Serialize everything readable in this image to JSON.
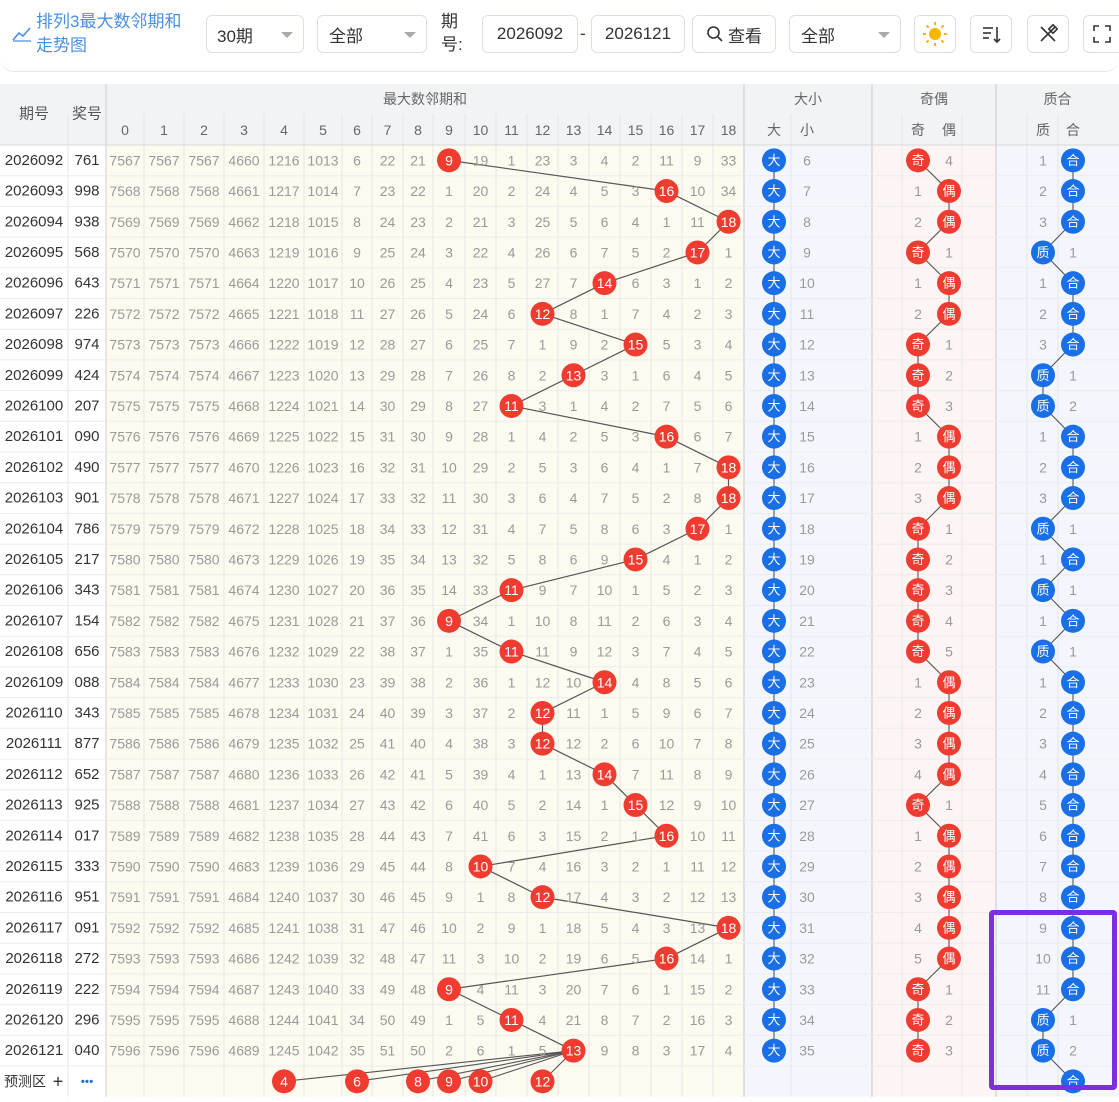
{
  "toolbar": {
    "title": "排列3最大数邻期和走势图",
    "periods_select": "30期",
    "scope_select": "全部",
    "period_label": "期号:",
    "start_issue": "2026092",
    "separator": "-",
    "end_issue": "2026121",
    "query_button": "查看",
    "filter_select": "全部",
    "icons": [
      "chart-line-icon",
      "sun-icon",
      "sort-icon",
      "tools-icon",
      "fullscreen-icon"
    ]
  },
  "table": {
    "col_issue": "期号",
    "col_prize": "奖号",
    "group_main": "最大数邻期和",
    "group_size": "大小",
    "group_parity": "奇偶",
    "group_prime": "质合",
    "main_cols": [
      "0",
      "1",
      "2",
      "3",
      "4",
      "5",
      "6",
      "7",
      "8",
      "9",
      "10",
      "11",
      "12",
      "13",
      "14",
      "15",
      "16",
      "17",
      "18"
    ],
    "size_cols": [
      "大",
      "小"
    ],
    "parity_cols": [
      "奇",
      "偶"
    ],
    "prime_cols": [
      "质",
      "合"
    ],
    "rows": [
      {
        "issue": "2026092",
        "prize": "761",
        "main": [
          "7567",
          "7567",
          "7567",
          "4660",
          "1216",
          "1013",
          "6",
          "22",
          "21",
          "9",
          "19",
          "1",
          "23",
          "3",
          "4",
          "2",
          "11",
          "9",
          "33"
        ],
        "hit": 9,
        "size_hit": "大",
        "size_val": "6",
        "parity_hit": "奇",
        "parity_val": "4",
        "prime_hit": "合",
        "prime_val": "1"
      },
      {
        "issue": "2026093",
        "prize": "998",
        "main": [
          "7568",
          "7568",
          "7568",
          "4661",
          "1217",
          "1014",
          "7",
          "23",
          "22",
          "1",
          "20",
          "2",
          "24",
          "4",
          "5",
          "3",
          "16",
          "10",
          "34"
        ],
        "hit": 16,
        "size_hit": "大",
        "size_val": "7",
        "parity_hit": "偶",
        "parity_val": "1",
        "prime_hit": "合",
        "prime_val": "2"
      },
      {
        "issue": "2026094",
        "prize": "938",
        "main": [
          "7569",
          "7569",
          "7569",
          "4662",
          "1218",
          "1015",
          "8",
          "24",
          "23",
          "2",
          "21",
          "3",
          "25",
          "5",
          "6",
          "4",
          "1",
          "11",
          "18"
        ],
        "hit": 18,
        "size_hit": "大",
        "size_val": "8",
        "parity_hit": "偶",
        "parity_val": "2",
        "prime_hit": "合",
        "prime_val": "3"
      },
      {
        "issue": "2026095",
        "prize": "568",
        "main": [
          "7570",
          "7570",
          "7570",
          "4663",
          "1219",
          "1016",
          "9",
          "25",
          "24",
          "3",
          "22",
          "4",
          "26",
          "6",
          "7",
          "5",
          "2",
          "17",
          "1"
        ],
        "hit": 17,
        "size_hit": "大",
        "size_val": "9",
        "parity_hit": "奇",
        "parity_val": "1",
        "prime_hit": "质",
        "prime_val": "1"
      },
      {
        "issue": "2026096",
        "prize": "643",
        "main": [
          "7571",
          "7571",
          "7571",
          "4664",
          "1220",
          "1017",
          "10",
          "26",
          "25",
          "4",
          "23",
          "5",
          "27",
          "7",
          "14",
          "6",
          "3",
          "1",
          "2"
        ],
        "hit": 14,
        "size_hit": "大",
        "size_val": "10",
        "parity_hit": "偶",
        "parity_val": "1",
        "prime_hit": "合",
        "prime_val": "1"
      },
      {
        "issue": "2026097",
        "prize": "226",
        "main": [
          "7572",
          "7572",
          "7572",
          "4665",
          "1221",
          "1018",
          "11",
          "27",
          "26",
          "5",
          "24",
          "6",
          "12",
          "8",
          "1",
          "7",
          "4",
          "2",
          "3"
        ],
        "hit": 12,
        "size_hit": "大",
        "size_val": "11",
        "parity_hit": "偶",
        "parity_val": "2",
        "prime_hit": "合",
        "prime_val": "2"
      },
      {
        "issue": "2026098",
        "prize": "974",
        "main": [
          "7573",
          "7573",
          "7573",
          "4666",
          "1222",
          "1019",
          "12",
          "28",
          "27",
          "6",
          "25",
          "7",
          "1",
          "9",
          "2",
          "15",
          "5",
          "3",
          "4"
        ],
        "hit": 15,
        "size_hit": "大",
        "size_val": "12",
        "parity_hit": "奇",
        "parity_val": "1",
        "prime_hit": "合",
        "prime_val": "3"
      },
      {
        "issue": "2026099",
        "prize": "424",
        "main": [
          "7574",
          "7574",
          "7574",
          "4667",
          "1223",
          "1020",
          "13",
          "29",
          "28",
          "7",
          "26",
          "8",
          "2",
          "13",
          "3",
          "1",
          "6",
          "4",
          "5"
        ],
        "hit": 13,
        "size_hit": "大",
        "size_val": "13",
        "parity_hit": "奇",
        "parity_val": "2",
        "prime_hit": "质",
        "prime_val": "1"
      },
      {
        "issue": "2026100",
        "prize": "207",
        "main": [
          "7575",
          "7575",
          "7575",
          "4668",
          "1224",
          "1021",
          "14",
          "30",
          "29",
          "8",
          "27",
          "11",
          "3",
          "1",
          "4",
          "2",
          "7",
          "5",
          "6"
        ],
        "hit": 11,
        "size_hit": "大",
        "size_val": "14",
        "parity_hit": "奇",
        "parity_val": "3",
        "prime_hit": "质",
        "prime_val": "2"
      },
      {
        "issue": "2026101",
        "prize": "090",
        "main": [
          "7576",
          "7576",
          "7576",
          "4669",
          "1225",
          "1022",
          "15",
          "31",
          "30",
          "9",
          "28",
          "1",
          "4",
          "2",
          "5",
          "3",
          "16",
          "6",
          "7"
        ],
        "hit": 16,
        "size_hit": "大",
        "size_val": "15",
        "parity_hit": "偶",
        "parity_val": "1",
        "prime_hit": "合",
        "prime_val": "1"
      },
      {
        "issue": "2026102",
        "prize": "490",
        "main": [
          "7577",
          "7577",
          "7577",
          "4670",
          "1226",
          "1023",
          "16",
          "32",
          "31",
          "10",
          "29",
          "2",
          "5",
          "3",
          "6",
          "4",
          "1",
          "7",
          "18"
        ],
        "hit": 18,
        "size_hit": "大",
        "size_val": "16",
        "parity_hit": "偶",
        "parity_val": "2",
        "prime_hit": "合",
        "prime_val": "2"
      },
      {
        "issue": "2026103",
        "prize": "901",
        "main": [
          "7578",
          "7578",
          "7578",
          "4671",
          "1227",
          "1024",
          "17",
          "33",
          "32",
          "11",
          "30",
          "3",
          "6",
          "4",
          "7",
          "5",
          "2",
          "8",
          "18"
        ],
        "hit": 18,
        "size_hit": "大",
        "size_val": "17",
        "parity_hit": "偶",
        "parity_val": "3",
        "prime_hit": "合",
        "prime_val": "3"
      },
      {
        "issue": "2026104",
        "prize": "786",
        "main": [
          "7579",
          "7579",
          "7579",
          "4672",
          "1228",
          "1025",
          "18",
          "34",
          "33",
          "12",
          "31",
          "4",
          "7",
          "5",
          "8",
          "6",
          "3",
          "17",
          "1"
        ],
        "hit": 17,
        "size_hit": "大",
        "size_val": "18",
        "parity_hit": "奇",
        "parity_val": "1",
        "prime_hit": "质",
        "prime_val": "1"
      },
      {
        "issue": "2026105",
        "prize": "217",
        "main": [
          "7580",
          "7580",
          "7580",
          "4673",
          "1229",
          "1026",
          "19",
          "35",
          "34",
          "13",
          "32",
          "5",
          "8",
          "6",
          "9",
          "15",
          "4",
          "1",
          "2"
        ],
        "hit": 15,
        "size_hit": "大",
        "size_val": "19",
        "parity_hit": "奇",
        "parity_val": "2",
        "prime_hit": "合",
        "prime_val": "1"
      },
      {
        "issue": "2026106",
        "prize": "343",
        "main": [
          "7581",
          "7581",
          "7581",
          "4674",
          "1230",
          "1027",
          "20",
          "36",
          "35",
          "14",
          "33",
          "11",
          "9",
          "7",
          "10",
          "1",
          "5",
          "2",
          "3"
        ],
        "hit": 11,
        "size_hit": "大",
        "size_val": "20",
        "parity_hit": "奇",
        "parity_val": "3",
        "prime_hit": "质",
        "prime_val": "1"
      },
      {
        "issue": "2026107",
        "prize": "154",
        "main": [
          "7582",
          "7582",
          "7582",
          "4675",
          "1231",
          "1028",
          "21",
          "37",
          "36",
          "9",
          "34",
          "1",
          "10",
          "8",
          "11",
          "2",
          "6",
          "3",
          "4"
        ],
        "hit": 9,
        "size_hit": "大",
        "size_val": "21",
        "parity_hit": "奇",
        "parity_val": "4",
        "prime_hit": "合",
        "prime_val": "1"
      },
      {
        "issue": "2026108",
        "prize": "656",
        "main": [
          "7583",
          "7583",
          "7583",
          "4676",
          "1232",
          "1029",
          "22",
          "38",
          "37",
          "1",
          "35",
          "11",
          "11",
          "9",
          "12",
          "3",
          "7",
          "4",
          "5"
        ],
        "hit": 11,
        "size_hit": "大",
        "size_val": "22",
        "parity_hit": "奇",
        "parity_val": "5",
        "prime_hit": "质",
        "prime_val": "1"
      },
      {
        "issue": "2026109",
        "prize": "088",
        "main": [
          "7584",
          "7584",
          "7584",
          "4677",
          "1233",
          "1030",
          "23",
          "39",
          "38",
          "2",
          "36",
          "1",
          "12",
          "10",
          "14",
          "4",
          "8",
          "5",
          "6"
        ],
        "hit": 14,
        "size_hit": "大",
        "size_val": "23",
        "parity_hit": "偶",
        "parity_val": "1",
        "prime_hit": "合",
        "prime_val": "1"
      },
      {
        "issue": "2026110",
        "prize": "343",
        "main": [
          "7585",
          "7585",
          "7585",
          "4678",
          "1234",
          "1031",
          "24",
          "40",
          "39",
          "3",
          "37",
          "2",
          "12",
          "11",
          "1",
          "5",
          "9",
          "6",
          "7"
        ],
        "hit": 12,
        "size_hit": "大",
        "size_val": "24",
        "parity_hit": "偶",
        "parity_val": "2",
        "prime_hit": "合",
        "prime_val": "2"
      },
      {
        "issue": "2026111",
        "prize": "877",
        "main": [
          "7586",
          "7586",
          "7586",
          "4679",
          "1235",
          "1032",
          "25",
          "41",
          "40",
          "4",
          "38",
          "3",
          "12",
          "12",
          "2",
          "6",
          "10",
          "7",
          "8"
        ],
        "hit": 12,
        "size_hit": "大",
        "size_val": "25",
        "parity_hit": "偶",
        "parity_val": "3",
        "prime_hit": "合",
        "prime_val": "3"
      },
      {
        "issue": "2026112",
        "prize": "652",
        "main": [
          "7587",
          "7587",
          "7587",
          "4680",
          "1236",
          "1033",
          "26",
          "42",
          "41",
          "5",
          "39",
          "4",
          "1",
          "13",
          "14",
          "7",
          "11",
          "8",
          "9"
        ],
        "hit": 14,
        "size_hit": "大",
        "size_val": "26",
        "parity_hit": "偶",
        "parity_val": "4",
        "prime_hit": "合",
        "prime_val": "4"
      },
      {
        "issue": "2026113",
        "prize": "925",
        "main": [
          "7588",
          "7588",
          "7588",
          "4681",
          "1237",
          "1034",
          "27",
          "43",
          "42",
          "6",
          "40",
          "5",
          "2",
          "14",
          "1",
          "15",
          "12",
          "9",
          "10"
        ],
        "hit": 15,
        "size_hit": "大",
        "size_val": "27",
        "parity_hit": "奇",
        "parity_val": "1",
        "prime_hit": "合",
        "prime_val": "5"
      },
      {
        "issue": "2026114",
        "prize": "017",
        "main": [
          "7589",
          "7589",
          "7589",
          "4682",
          "1238",
          "1035",
          "28",
          "44",
          "43",
          "7",
          "41",
          "6",
          "3",
          "15",
          "2",
          "1",
          "16",
          "10",
          "11"
        ],
        "hit": 16,
        "size_hit": "大",
        "size_val": "28",
        "parity_hit": "偶",
        "parity_val": "1",
        "prime_hit": "合",
        "prime_val": "6"
      },
      {
        "issue": "2026115",
        "prize": "333",
        "main": [
          "7590",
          "7590",
          "7590",
          "4683",
          "1239",
          "1036",
          "29",
          "45",
          "44",
          "8",
          "10",
          "7",
          "4",
          "16",
          "3",
          "2",
          "1",
          "11",
          "12"
        ],
        "hit": 10,
        "size_hit": "大",
        "size_val": "29",
        "parity_hit": "偶",
        "parity_val": "2",
        "prime_hit": "合",
        "prime_val": "7"
      },
      {
        "issue": "2026116",
        "prize": "951",
        "main": [
          "7591",
          "7591",
          "7591",
          "4684",
          "1240",
          "1037",
          "30",
          "46",
          "45",
          "9",
          "1",
          "8",
          "12",
          "17",
          "4",
          "3",
          "2",
          "12",
          "13"
        ],
        "hit": 12,
        "size_hit": "大",
        "size_val": "30",
        "parity_hit": "偶",
        "parity_val": "3",
        "prime_hit": "合",
        "prime_val": "8"
      },
      {
        "issue": "2026117",
        "prize": "091",
        "main": [
          "7592",
          "7592",
          "7592",
          "4685",
          "1241",
          "1038",
          "31",
          "47",
          "46",
          "10",
          "2",
          "9",
          "1",
          "18",
          "5",
          "4",
          "3",
          "13",
          "18"
        ],
        "hit": 18,
        "size_hit": "大",
        "size_val": "31",
        "parity_hit": "偶",
        "parity_val": "4",
        "prime_hit": "合",
        "prime_val": "9"
      },
      {
        "issue": "2026118",
        "prize": "272",
        "main": [
          "7593",
          "7593",
          "7593",
          "4686",
          "1242",
          "1039",
          "32",
          "48",
          "47",
          "11",
          "3",
          "10",
          "2",
          "19",
          "6",
          "5",
          "16",
          "14",
          "1"
        ],
        "hit": 16,
        "size_hit": "大",
        "size_val": "32",
        "parity_hit": "偶",
        "parity_val": "5",
        "prime_hit": "合",
        "prime_val": "10"
      },
      {
        "issue": "2026119",
        "prize": "222",
        "main": [
          "7594",
          "7594",
          "7594",
          "4687",
          "1243",
          "1040",
          "33",
          "49",
          "48",
          "9",
          "4",
          "11",
          "3",
          "20",
          "7",
          "6",
          "1",
          "15",
          "2"
        ],
        "hit": 9,
        "size_hit": "大",
        "size_val": "33",
        "parity_hit": "奇",
        "parity_val": "1",
        "prime_hit": "合",
        "prime_val": "11"
      },
      {
        "issue": "2026120",
        "prize": "296",
        "main": [
          "7595",
          "7595",
          "7595",
          "4688",
          "1244",
          "1041",
          "34",
          "50",
          "49",
          "1",
          "5",
          "11",
          "4",
          "21",
          "8",
          "7",
          "2",
          "16",
          "3"
        ],
        "hit": 11,
        "size_hit": "大",
        "size_val": "34",
        "parity_hit": "奇",
        "parity_val": "2",
        "prime_hit": "质",
        "prime_val": "1"
      },
      {
        "issue": "2026121",
        "prize": "040",
        "main": [
          "7596",
          "7596",
          "7596",
          "4689",
          "1245",
          "1042",
          "35",
          "51",
          "50",
          "2",
          "6",
          "1",
          "5",
          "13",
          "9",
          "8",
          "3",
          "17",
          "4"
        ],
        "hit": 13,
        "size_hit": "大",
        "size_val": "35",
        "parity_hit": "奇",
        "parity_val": "3",
        "prime_hit": "质",
        "prime_val": "2"
      }
    ],
    "predict": {
      "label": "预测区",
      "plus": "+",
      "more": "•••",
      "balls": [
        4,
        6,
        8,
        9,
        10,
        12
      ],
      "prime_ball": "合"
    }
  },
  "colors": {
    "red_ball": "#f03c30",
    "blue_ball": "#1a6fe6",
    "highlight_box": "#7b2fe0",
    "title_blue": "#4a90e2",
    "line": "#555555"
  }
}
